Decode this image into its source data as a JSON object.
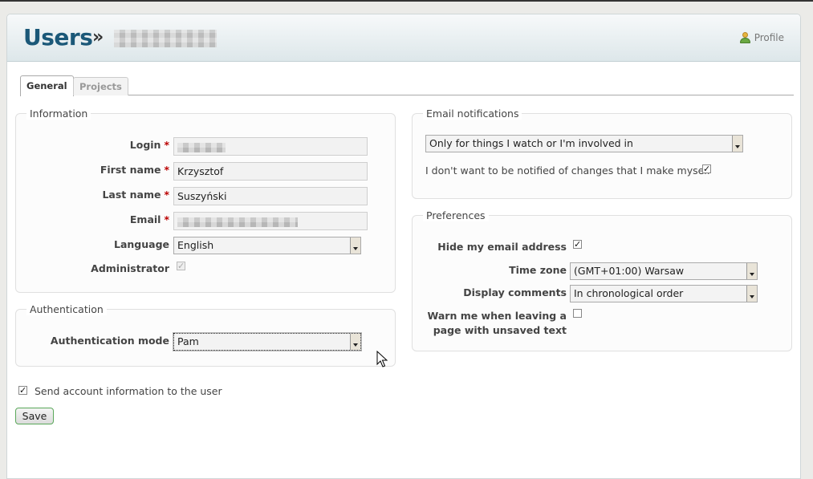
{
  "header": {
    "title": "Users",
    "separator": "»",
    "profile_label": "Profile"
  },
  "tabs": [
    {
      "label": "General",
      "active": true
    },
    {
      "label": "Projects",
      "active": false
    }
  ],
  "information": {
    "legend": "Information",
    "login": {
      "label": "Login",
      "required_mark": "*"
    },
    "first_name": {
      "label": "First name",
      "required_mark": "*",
      "value": "Krzysztof"
    },
    "last_name": {
      "label": "Last name",
      "required_mark": "*",
      "value": "Suszyński"
    },
    "email": {
      "label": "Email",
      "required_mark": "*"
    },
    "language": {
      "label": "Language",
      "value": "English"
    },
    "administrator": {
      "label": "Administrator",
      "checked": true,
      "disabled": true
    }
  },
  "authentication": {
    "legend": "Authentication",
    "mode": {
      "label": "Authentication mode",
      "value": "Pam"
    }
  },
  "send_info": {
    "label": "Send account information to the user",
    "checked": true
  },
  "save_label": "Save",
  "email_notifications": {
    "legend": "Email notifications",
    "option": "Only for things I watch or I'm involved in",
    "no_self_label": "I don't want to be notified of changes that I make myself",
    "no_self_checked": true
  },
  "preferences": {
    "legend": "Preferences",
    "hide_email": {
      "label": "Hide my email address",
      "checked": true
    },
    "time_zone": {
      "label": "Time zone",
      "value": "(GMT+01:00) Warsaw"
    },
    "display_comments": {
      "label": "Display comments",
      "value": "In chronological order"
    },
    "warn_leave": {
      "label_line1": "Warn me when leaving a",
      "label_line2": "page with unsaved text",
      "checked": false
    }
  },
  "check_mark": "✓"
}
